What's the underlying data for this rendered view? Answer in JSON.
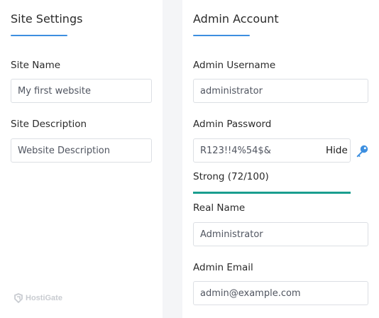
{
  "site_settings": {
    "title": "Site Settings",
    "site_name": {
      "label": "Site Name",
      "value": "My first website"
    },
    "site_description": {
      "label": "Site Description",
      "value": "Website Description"
    }
  },
  "admin_account": {
    "title": "Admin Account",
    "username": {
      "label": "Admin Username",
      "value": "administrator"
    },
    "password": {
      "label": "Admin Password",
      "value": "R123!!4%54$&",
      "toggle_label": "Hide",
      "strength_text": "Strong (72/100)",
      "strength_score": 72
    },
    "real_name": {
      "label": "Real Name",
      "value": "Administrator"
    },
    "email": {
      "label": "Admin Email",
      "value": "admin@example.com"
    }
  },
  "branding": {
    "watermark": "HostiGate"
  },
  "colors": {
    "accent": "#3d8fe0",
    "strength": "#1a9e8f",
    "key_icon": "#3d8fe0"
  },
  "icons": {
    "generate_password": "key-icon",
    "logo": "hostigate-logo-icon"
  }
}
